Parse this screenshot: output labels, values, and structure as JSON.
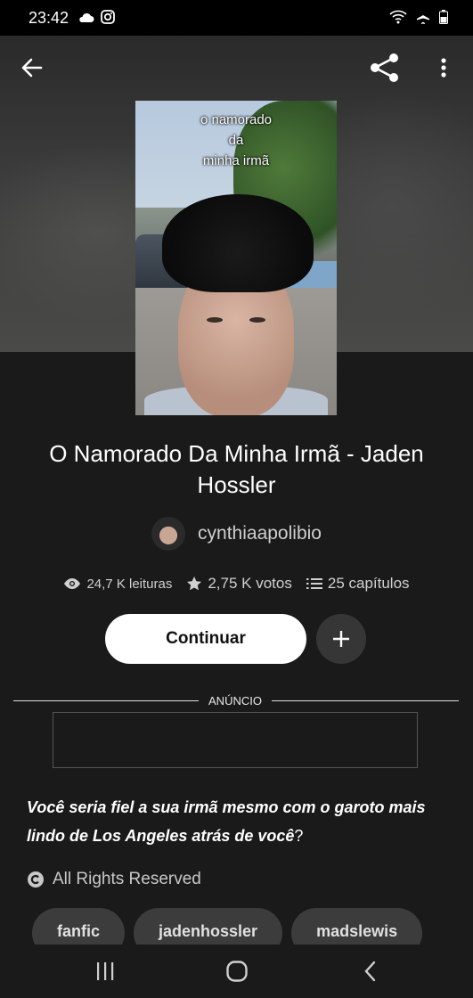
{
  "status_bar": {
    "time": "23:42"
  },
  "cover": {
    "overlay_text": "o namorado\nda\nminha irmã"
  },
  "story": {
    "title": "O Namorado Da Minha Irmã - Jaden Hossler",
    "author": "cynthiaapolibio",
    "reads": "24,7 K leituras",
    "votes": "2,75 K votos",
    "chapters": "25 capítulos"
  },
  "actions": {
    "continue_label": "Continuar"
  },
  "ad": {
    "label": "ANÚNCIO"
  },
  "description": {
    "bold_text": "Você seria fiel a sua irmã mesmo com o garoto mais lindo de Los Angeles atrás de você",
    "suffix": "?"
  },
  "copyright": {
    "label": "All Rights Reserved"
  },
  "tags": [
    "fanfic",
    "jadenhossler",
    "madslewis"
  ],
  "colors": {
    "background": "#1a1a1a",
    "button_bg": "#ffffff",
    "tag_bg": "#3c3c3c"
  }
}
